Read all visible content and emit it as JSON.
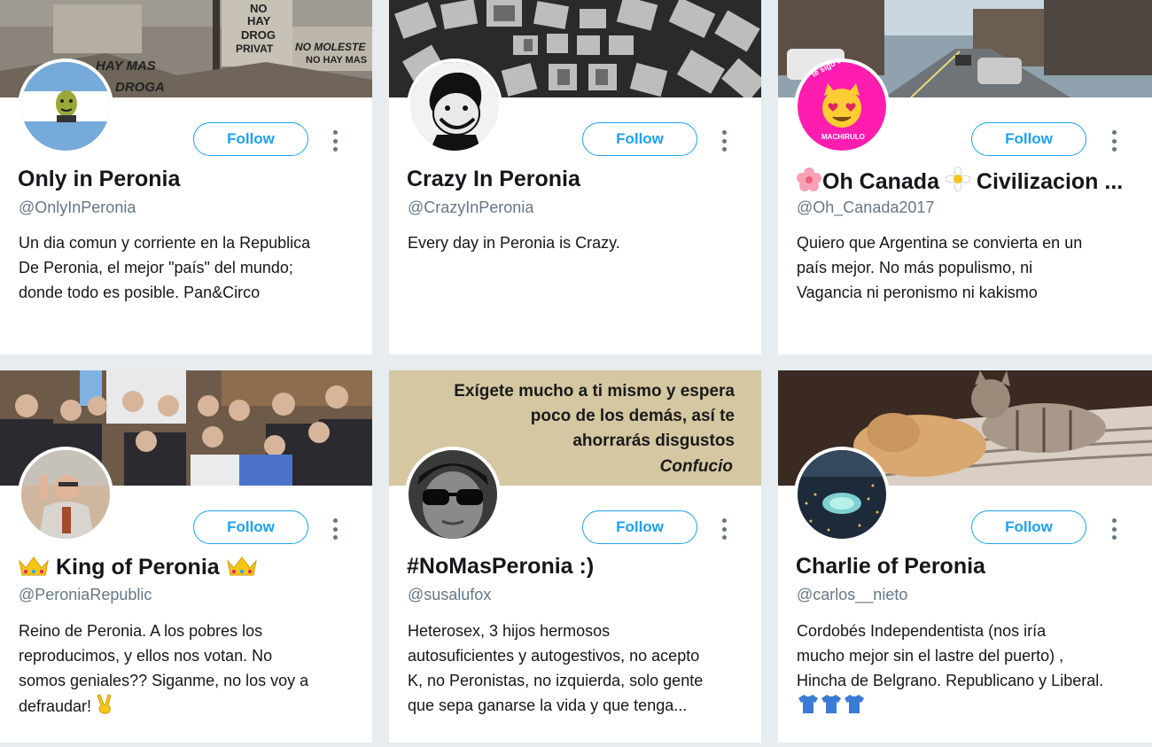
{
  "follow_label": "Follow",
  "accent_color": "#1da1f2",
  "cards": [
    {
      "name": "Only in Peronia",
      "handle": "@OnlyInPeronia",
      "bio_lines": [
        "Un dia comun y corriente en la Republica",
        "De Peronia, el mejor \"país\" del mundo;",
        "donde todo es posible. Pan&Circo"
      ],
      "banner_text": [
        "NO",
        "HAY",
        "DROG",
        "PRIVAT",
        "NO MOLESTE",
        "NO HAY MAS",
        "HAY MAS",
        "DROGA"
      ]
    },
    {
      "name": "Crazy In Peronia",
      "handle": "@CrazyInPeronia",
      "bio_lines": [
        "Every day in Peronia is Crazy."
      ]
    },
    {
      "name_prefix_icon": "flower-icon",
      "name_text_1": "Oh Canada",
      "name_mid_icon": "daisy-icon",
      "name_text_2": "Civilizacion ...",
      "handle": "@Oh_Canada2017",
      "bio_lines": [
        "Quiero que Argentina se convierta en un",
        "país mejor. No más populismo, ni",
        "Vagancia ni peronismo ni kakismo"
      ],
      "avatar_text_top": "te sigo eligiendo",
      "avatar_text_bottom": "MACHIRULO"
    },
    {
      "name_icon": "crown-icon",
      "name": "King of Peronia",
      "handle": "@PeroniaRepublic",
      "bio_lines": [
        "Reino de Peronia. A los pobres los",
        "reproducimos, y ellos nos votan. No",
        "somos geniales?? Siganme, no los voy a",
        "defraudar!"
      ],
      "bio_end_icon": "victory-hand-icon"
    },
    {
      "name": "#NoMasPeronia :)",
      "handle": "@susalufox",
      "bio_lines": [
        "Heterosex, 3 hijos hermosos",
        "autosuficientes y autogestivos, no acepto",
        "K, no Peronistas, no izquierda, solo gente",
        "que sepa ganarse la vida y que tenga..."
      ],
      "banner_quote": [
        "Exígete mucho a ti mismo y espera",
        "poco de los demás, así te",
        "ahorrarás disgustos"
      ],
      "banner_author": "Confucio"
    },
    {
      "name": "Charlie of Peronia",
      "handle": "@carlos__nieto",
      "bio_lines": [
        "Cordobés Independentista (nos iría",
        "mucho mejor sin el lastre del puerto) ,",
        "Hincha de Belgrano. Republicano y Liberal."
      ],
      "bio_icons": [
        "tshirt-icon",
        "tshirt-icon",
        "tshirt-icon"
      ]
    }
  ]
}
